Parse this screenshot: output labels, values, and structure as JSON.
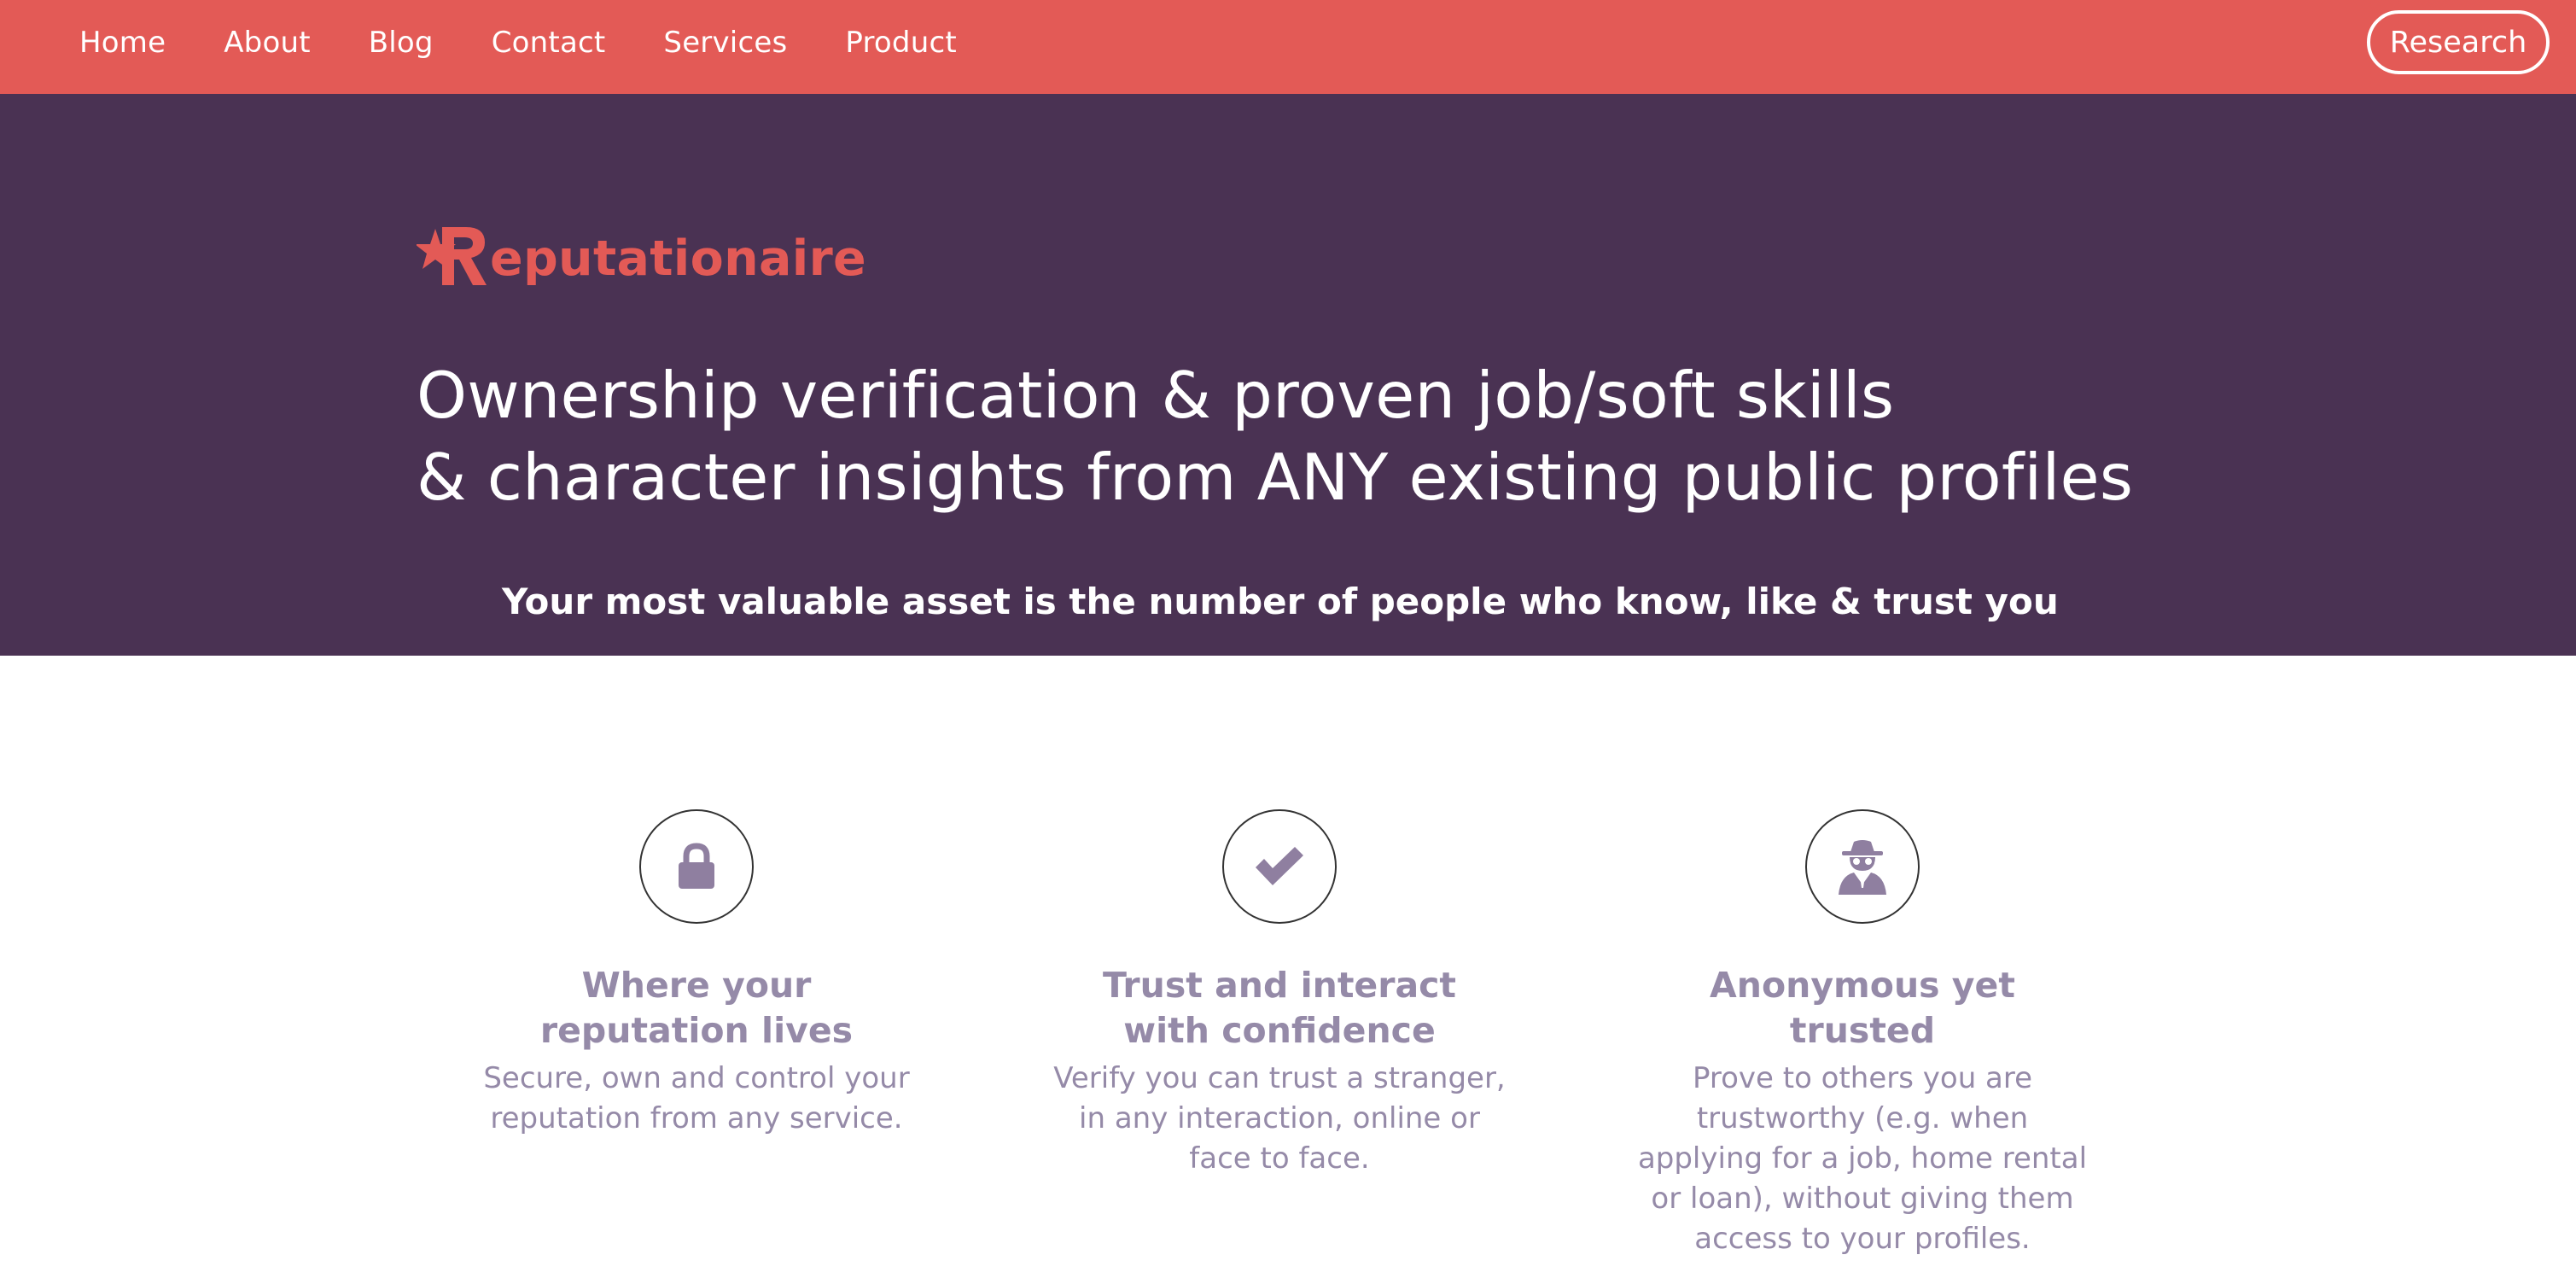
{
  "nav": {
    "links": [
      "Home",
      "About",
      "Blog",
      "Contact",
      "Services",
      "Product"
    ],
    "cta_label": "Research"
  },
  "hero": {
    "logo_text": "eputationaire",
    "logo_letter": "R",
    "headline_line1": "Ownership verification & proven job/soft skills",
    "headline_line2": "& character insights from ANY existing public profiles",
    "tagline": "Your most valuable asset is the number of people who know, like & trust you"
  },
  "features": [
    {
      "icon": "lock-icon",
      "title": "Where your reputation lives",
      "text": "Secure, own and control your reputation from any service."
    },
    {
      "icon": "checkmark-icon",
      "title": "Trust and interact with confidence",
      "text": "Verify you can trust a stranger, in any interaction, online or face to face."
    },
    {
      "icon": "spy-icon",
      "title": "Anonymous yet trusted",
      "text": "Prove to others you are trustworthy (e.g. when applying for a job, home rental or loan), without giving them access to your profiles."
    }
  ],
  "colors": {
    "nav_bg": "#e35a56",
    "hero_bg": "#4a3253",
    "brand": "#e35a56",
    "feature_text": "#958aa8",
    "icon_fill": "#8f7fa0"
  }
}
